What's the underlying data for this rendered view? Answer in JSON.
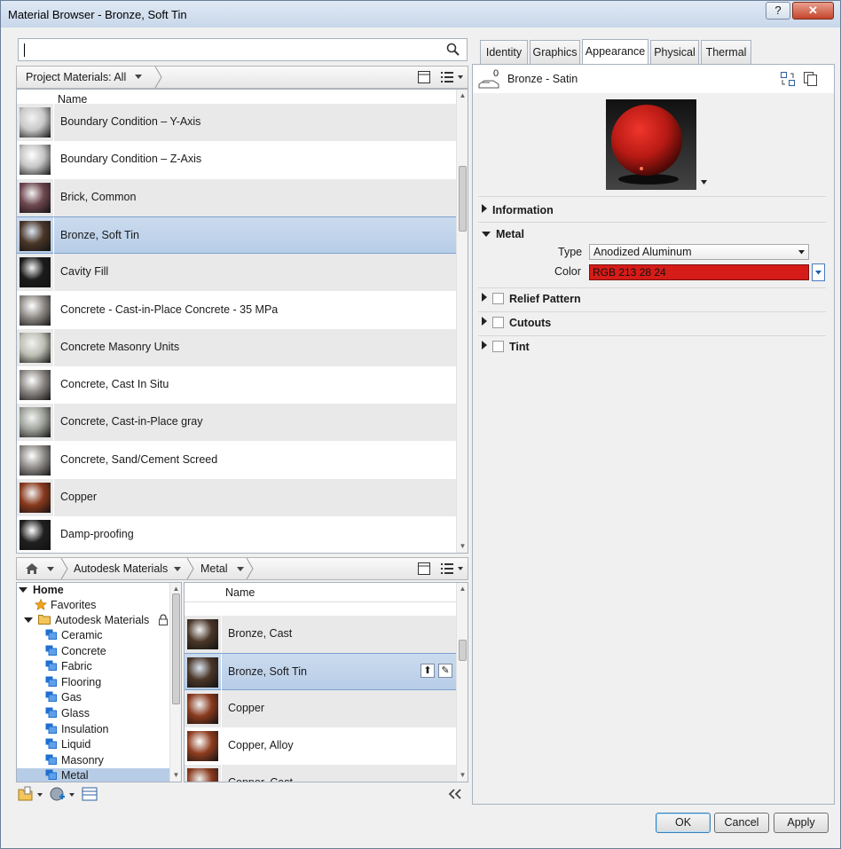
{
  "window": {
    "title": "Material Browser - Bronze, Soft Tin",
    "help_label": "?",
    "close_label": "✕"
  },
  "search": {
    "value": "",
    "placeholder": ""
  },
  "project_bar": {
    "filter_label": "Project Materials: All"
  },
  "project_list": {
    "header": "Name",
    "rows": [
      {
        "label": "Boundary Condition – Y-Axis",
        "swatch": "#c9c9c9"
      },
      {
        "label": "Boundary Condition – Z-Axis",
        "swatch": "#c4c4c4"
      },
      {
        "label": "Brick, Common",
        "swatch": "#6e4750"
      },
      {
        "label": "Bronze, Soft Tin",
        "swatch": "#4a3628"
      },
      {
        "label": "Cavity Fill",
        "swatch": "#1b1b1b"
      },
      {
        "label": "Concrete - Cast-in-Place Concrete - 35 MPa",
        "swatch": "#8e8a86"
      },
      {
        "label": "Concrete Masonry Units",
        "swatch": "#bdbfb4"
      },
      {
        "label": "Concrete, Cast In Situ",
        "swatch": "#8b8784"
      },
      {
        "label": "Concrete, Cast-in-Place gray",
        "swatch": "#9ea29a"
      },
      {
        "label": "Concrete, Sand/Cement Screed",
        "swatch": "#8f8c89"
      },
      {
        "label": "Copper",
        "swatch": "#8a3a1e"
      },
      {
        "label": "Damp-proofing",
        "swatch": "#1f1f1f"
      }
    ]
  },
  "library_bar": {
    "crumbs": [
      "Autodesk Materials",
      "Metal"
    ]
  },
  "tree": {
    "home": "Home",
    "favorites": "Favorites",
    "library": "Autodesk Materials",
    "categories": [
      "Ceramic",
      "Concrete",
      "Fabric",
      "Flooring",
      "Gas",
      "Glass",
      "Insulation",
      "Liquid",
      "Masonry",
      "Metal"
    ]
  },
  "library_list": {
    "header": "Name",
    "rows": [
      {
        "label": "Bronze, Cast",
        "swatch": "#4a3628"
      },
      {
        "label": "Bronze, Soft Tin",
        "swatch": "#4a3628"
      },
      {
        "label": "Copper",
        "swatch": "#8a3a1e"
      },
      {
        "label": "Copper, Alloy",
        "swatch": "#8f3d1f"
      },
      {
        "label": "Copper, Cast",
        "swatch": "#8a3a1e"
      }
    ]
  },
  "tabs": [
    "Identity",
    "Graphics",
    "Appearance",
    "Physical",
    "Thermal"
  ],
  "active_tab": "Appearance",
  "asset": {
    "name": "Bronze - Satin",
    "usage_count": "0"
  },
  "sections": {
    "information": "Information",
    "metal": "Metal",
    "relief": "Relief Pattern",
    "cutouts": "Cutouts",
    "tint": "Tint"
  },
  "metal": {
    "type_label": "Type",
    "type_value": "Anodized Aluminum",
    "color_label": "Color",
    "color_value": "RGB 213 28 24",
    "color_hex": "#d51c18"
  },
  "buttons": {
    "ok": "OK",
    "cancel": "Cancel",
    "apply": "Apply"
  },
  "colors": {
    "selection": "#b7cde7",
    "accent": "#3c7fb1"
  }
}
